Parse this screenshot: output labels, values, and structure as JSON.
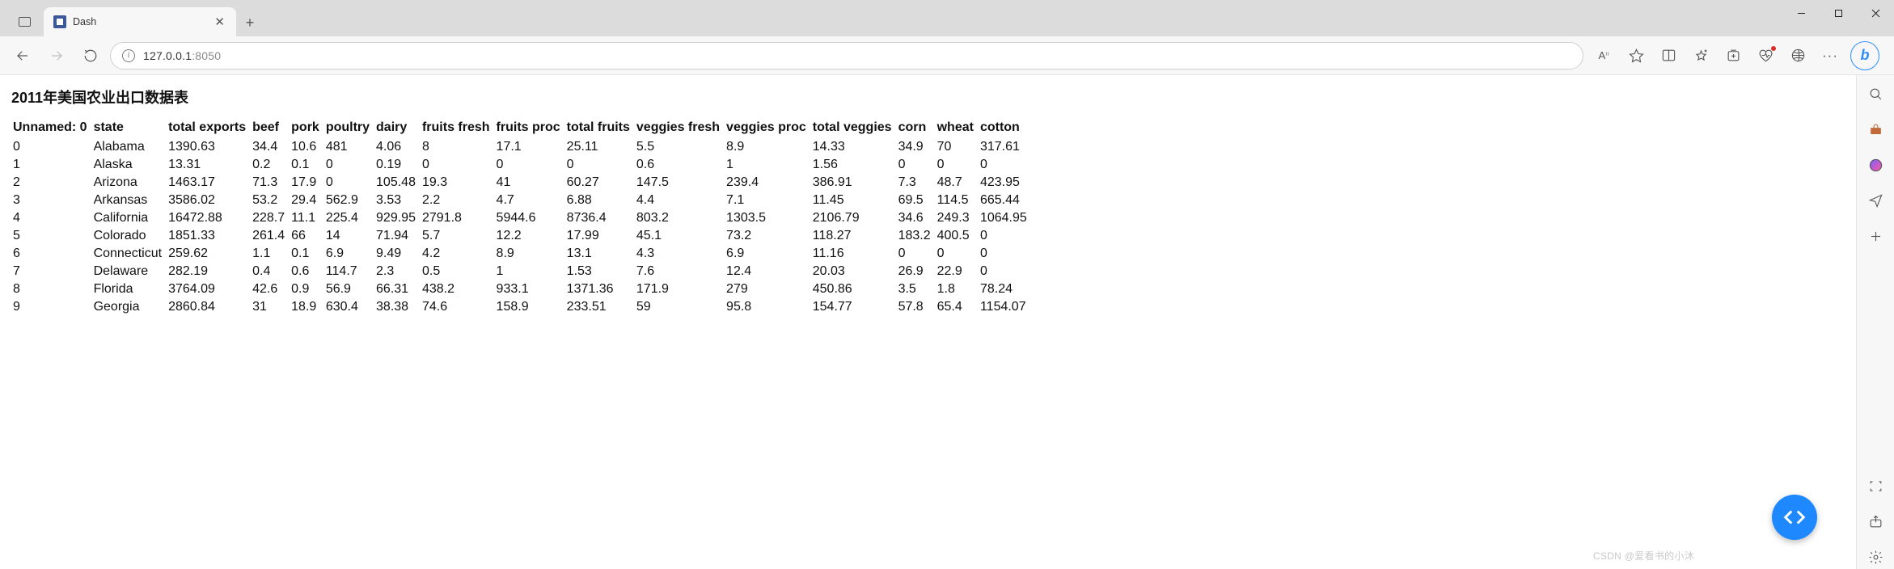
{
  "browser": {
    "tab_title": "Dash",
    "url_host": "127.0.0.1",
    "url_port": ":8050",
    "font_indicator": "A",
    "more": "···"
  },
  "page": {
    "heading": "2011年美国农业出口数据表",
    "columns": [
      "Unnamed: 0",
      "state",
      "total exports",
      "beef",
      "pork",
      "poultry",
      "dairy",
      "fruits fresh",
      "fruits proc",
      "total fruits",
      "veggies fresh",
      "veggies proc",
      "total veggies",
      "corn",
      "wheat",
      "cotton"
    ],
    "rows": [
      [
        "0",
        "Alabama",
        "1390.63",
        "34.4",
        "10.6",
        "481",
        "4.06",
        "8",
        "17.1",
        "25.11",
        "5.5",
        "8.9",
        "14.33",
        "34.9",
        "70",
        "317.61"
      ],
      [
        "1",
        "Alaska",
        "13.31",
        "0.2",
        "0.1",
        "0",
        "0.19",
        "0",
        "0",
        "0",
        "0.6",
        "1",
        "1.56",
        "0",
        "0",
        "0"
      ],
      [
        "2",
        "Arizona",
        "1463.17",
        "71.3",
        "17.9",
        "0",
        "105.48",
        "19.3",
        "41",
        "60.27",
        "147.5",
        "239.4",
        "386.91",
        "7.3",
        "48.7",
        "423.95"
      ],
      [
        "3",
        "Arkansas",
        "3586.02",
        "53.2",
        "29.4",
        "562.9",
        "3.53",
        "2.2",
        "4.7",
        "6.88",
        "4.4",
        "7.1",
        "11.45",
        "69.5",
        "114.5",
        "665.44"
      ],
      [
        "4",
        "California",
        "16472.88",
        "228.7",
        "11.1",
        "225.4",
        "929.95",
        "2791.8",
        "5944.6",
        "8736.4",
        "803.2",
        "1303.5",
        "2106.79",
        "34.6",
        "249.3",
        "1064.95"
      ],
      [
        "5",
        "Colorado",
        "1851.33",
        "261.4",
        "66",
        "14",
        "71.94",
        "5.7",
        "12.2",
        "17.99",
        "45.1",
        "73.2",
        "118.27",
        "183.2",
        "400.5",
        "0"
      ],
      [
        "6",
        "Connecticut",
        "259.62",
        "1.1",
        "0.1",
        "6.9",
        "9.49",
        "4.2",
        "8.9",
        "13.1",
        "4.3",
        "6.9",
        "11.16",
        "0",
        "0",
        "0"
      ],
      [
        "7",
        "Delaware",
        "282.19",
        "0.4",
        "0.6",
        "114.7",
        "2.3",
        "0.5",
        "1",
        "1.53",
        "7.6",
        "12.4",
        "20.03",
        "26.9",
        "22.9",
        "0"
      ],
      [
        "8",
        "Florida",
        "3764.09",
        "42.6",
        "0.9",
        "56.9",
        "66.31",
        "438.2",
        "933.1",
        "1371.36",
        "171.9",
        "279",
        "450.86",
        "3.5",
        "1.8",
        "78.24"
      ],
      [
        "9",
        "Georgia",
        "2860.84",
        "31",
        "18.9",
        "630.4",
        "38.38",
        "74.6",
        "158.9",
        "233.51",
        "59",
        "95.8",
        "154.77",
        "57.8",
        "65.4",
        "1154.07"
      ]
    ]
  },
  "watermark": "CSDN @爱看书的小沐"
}
